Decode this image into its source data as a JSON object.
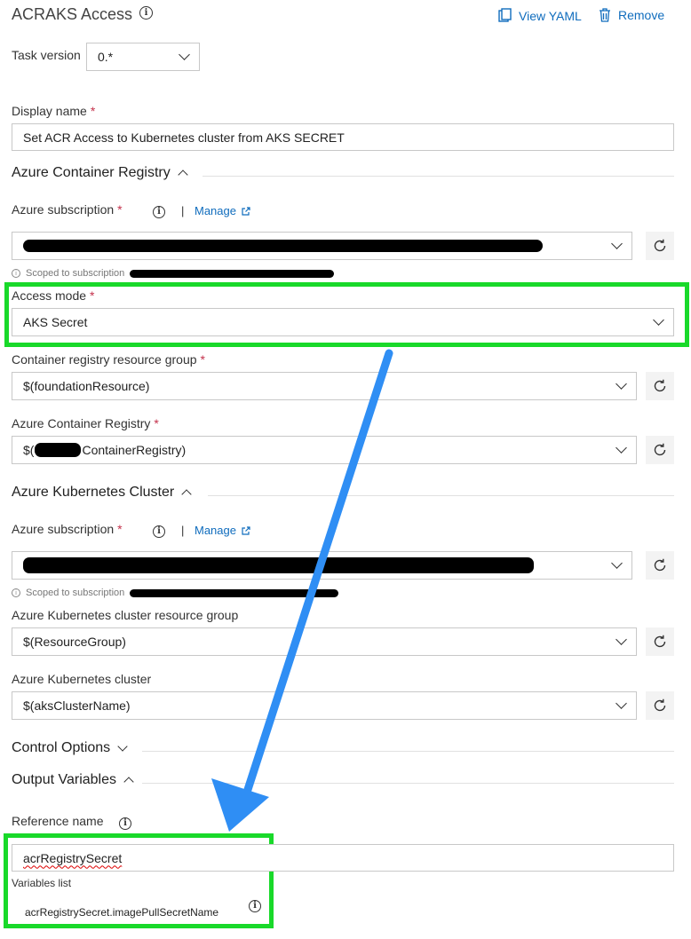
{
  "header": {
    "title": "ACRAKS Access",
    "view_yaml": "View YAML",
    "remove": "Remove"
  },
  "task_version": {
    "label": "Task version",
    "value": "0.*"
  },
  "display_name": {
    "label": "Display name",
    "required": "*",
    "value": "Set ACR Access to Kubernetes cluster from AKS SECRET"
  },
  "acr_section": {
    "title": "Azure Container Registry",
    "subscription_label": "Azure subscription",
    "required": "*",
    "separator": "|",
    "manage": "Manage",
    "scoped_prefix": "Scoped to subscription",
    "access_mode_label": "Access mode",
    "access_mode_value": "AKS Secret",
    "resource_group_label": "Container registry resource group",
    "resource_group_value": "$(foundationResource)",
    "registry_label": "Azure Container Registry",
    "registry_prefix": "$(",
    "registry_value": "ContainerRegistry)"
  },
  "aks_section": {
    "title": "Azure Kubernetes Cluster",
    "subscription_label": "Azure subscription",
    "required": "*",
    "separator": "|",
    "manage": "Manage",
    "scoped_prefix": "Scoped to subscription",
    "resource_group_label": "Azure Kubernetes cluster resource group",
    "resource_group_value": "$(ResourceGroup)",
    "cluster_label": "Azure Kubernetes cluster",
    "cluster_value": "$(aksClusterName)"
  },
  "control_options": {
    "title": "Control Options"
  },
  "output_variables": {
    "title": "Output Variables",
    "reference_label": "Reference name",
    "reference_value": "acrRegistrySecret",
    "variables_list_label": "Variables list",
    "variable_item": "acrRegistrySecret.imagePullSecretName"
  },
  "colors": {
    "highlight": "#19d92a",
    "arrow": "#2f8ef4",
    "link": "#0f6cbd"
  }
}
